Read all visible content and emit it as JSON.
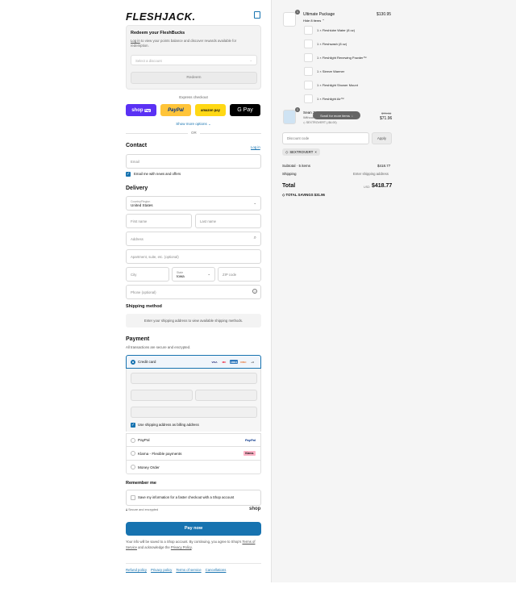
{
  "brand": {
    "logo_text": "FLESHJACK."
  },
  "redeem": {
    "title": "Redeem your FleshBucks",
    "login_link": "Log in",
    "text_rest": " to view your points balance and discover rewards available for redemption.",
    "select_placeholder": "Select a discount",
    "button": "Redeem"
  },
  "express": {
    "label": "Express checkout",
    "shoppay": "shop",
    "shoppay_tag": "Pay",
    "paypal": "PayPal",
    "amazon": "amazon pay",
    "gpay": "G Pay",
    "more_options": "Show more options"
  },
  "or_text": "OR",
  "contact": {
    "title": "Contact",
    "login": "Log in",
    "email_placeholder": "Email",
    "news_label": "Email me with news and offers"
  },
  "delivery": {
    "title": "Delivery",
    "country_label": "Country/Region",
    "country_value": "United States",
    "first_name": "First name",
    "last_name": "Last name",
    "address": "Address",
    "apartment": "Apartment, suite, etc. (optional)",
    "city": "City",
    "state_label": "State",
    "state_value": "Iowa",
    "zip": "ZIP code",
    "phone": "Phone (optional)"
  },
  "shipping": {
    "title": "Shipping method",
    "message": "Enter your shipping address to view available shipping methods."
  },
  "payment": {
    "title": "Payment",
    "subtitle": "All transactions are secure and encrypted.",
    "credit_card": "Credit card",
    "card_logos": [
      "VISA",
      "MC",
      "AMEX",
      "DISC"
    ],
    "more_cards": "+4",
    "billing_label": "Use shipping address as billing address",
    "paypal": "PayPal",
    "paypal_logo": "PayPal",
    "klarna": "Klarna - Flexible payments",
    "klarna_logo": "Klarna.",
    "money_order": "Money Order"
  },
  "remember": {
    "title": "Remember me",
    "save_label": "Save my information for a faster checkout with a Shop account",
    "secure": "Secure and encrypted",
    "shop_logo": "shop"
  },
  "paynow": "Pay now",
  "legal": {
    "text1": "Your info will be saved to a Shop account. By continuing, you agree to Shop's ",
    "terms": "Terms of Service",
    "text2": " and acknowledge the ",
    "privacy": "Privacy Policy",
    "text3": "."
  },
  "footer": [
    "Refund policy",
    "Privacy policy",
    "Terms of service",
    "Cancellations"
  ],
  "order": {
    "package": {
      "badge": "1",
      "name": "Ultimate Package",
      "price": "$130.95",
      "toggle": "Hide 8 items",
      "items": [
        "1 × Fleshlube Water (8 oz)",
        "1 × Fleshwash (8 oz)",
        "1 × Fleshlight Renewing Powder™",
        "1 × Sleeve Warmer",
        "1 × Fleshlight Shower Mount",
        "1 × Fleshlight Air™"
      ]
    },
    "second": {
      "badge": "1",
      "name": "Sean Z",
      "sub": "Without",
      "code": "SEXTROVERT (-$4.00)",
      "old_price": "$79.96",
      "price": "$71.96"
    },
    "tooltip": "Scroll for more items",
    "discount_placeholder": "Discount code",
    "apply": "Apply",
    "applied_code": "SEXTROVERT",
    "subtotal_label": "Subtotal · 5 items",
    "subtotal_value": "$418.77",
    "shipping_label": "Shipping",
    "shipping_value": "Enter shipping address",
    "total_label": "Total",
    "currency": "USD",
    "total_value": "$418.77",
    "savings_label": "TOTAL SAVINGS",
    "savings_value": "$31.96"
  }
}
